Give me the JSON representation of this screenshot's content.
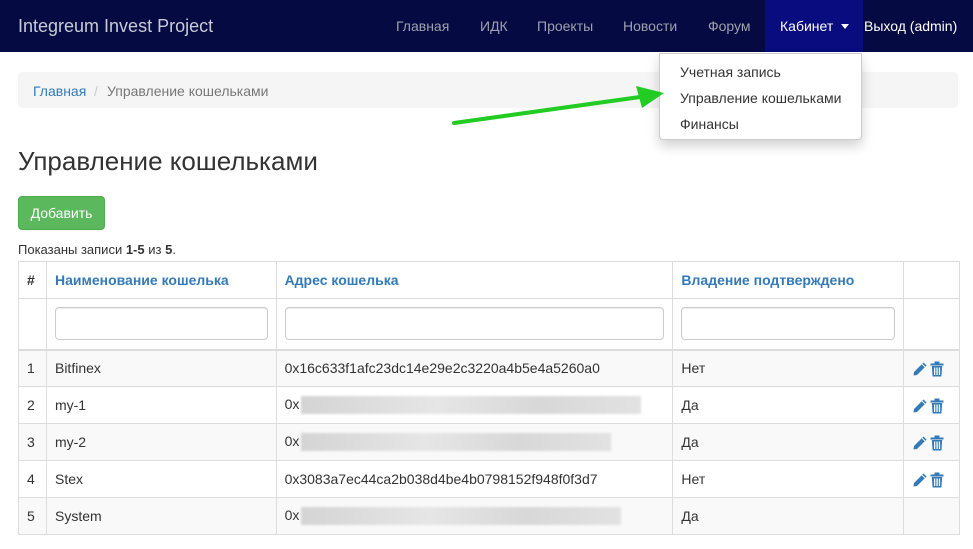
{
  "navbar": {
    "brand": "Integreum Invest Project",
    "items": [
      "Главная",
      "ИДК",
      "Проекты",
      "Новости",
      "Форум"
    ],
    "active_item": "Кабинет",
    "logout": "Выход (admin)"
  },
  "dropdown": {
    "items": [
      "Учетная запись",
      "Управление кошельками",
      "Финансы"
    ]
  },
  "breadcrumb": {
    "home": "Главная",
    "separator": "/",
    "current": "Управление кошельками"
  },
  "page": {
    "title": "Управление кошельками",
    "add_button": "Добавить",
    "summary_prefix": "Показаны записи ",
    "summary_range": "1-5",
    "summary_mid": " из ",
    "summary_total": "5",
    "summary_suffix": "."
  },
  "table": {
    "headers": [
      "#",
      "Наименование кошелька",
      "Адрес кошелька",
      "Владение подтверждено"
    ],
    "rows": [
      {
        "num": "1",
        "name": "Bitfinex",
        "address": "0x16c633f1afc23dc14e29e2c3220a4b5e4a5260a0",
        "address_redacted": false,
        "confirmed": "Нет",
        "actions": true
      },
      {
        "num": "2",
        "name": "my-1",
        "address": "0x",
        "address_redacted": true,
        "confirmed": "Да",
        "actions": true
      },
      {
        "num": "3",
        "name": "my-2",
        "address": "0x",
        "address_redacted": true,
        "confirmed": "Да",
        "actions": true
      },
      {
        "num": "4",
        "name": "Stex",
        "address": "0x3083a7ec44ca2b038d4be4b0798152f948f0f3d7",
        "address_redacted": false,
        "confirmed": "Нет",
        "actions": true
      },
      {
        "num": "5",
        "name": "System",
        "address": "0x",
        "address_redacted": true,
        "confirmed": "Да",
        "actions": false
      }
    ]
  },
  "icons": {
    "edit": "pencil-icon",
    "delete": "trash-icon"
  },
  "colors": {
    "navbar_bg": "#060a42",
    "navbar_active_bg": "#080c7e",
    "link": "#337ab7",
    "success": "#5cb85c",
    "arrow": "#22cc22"
  }
}
